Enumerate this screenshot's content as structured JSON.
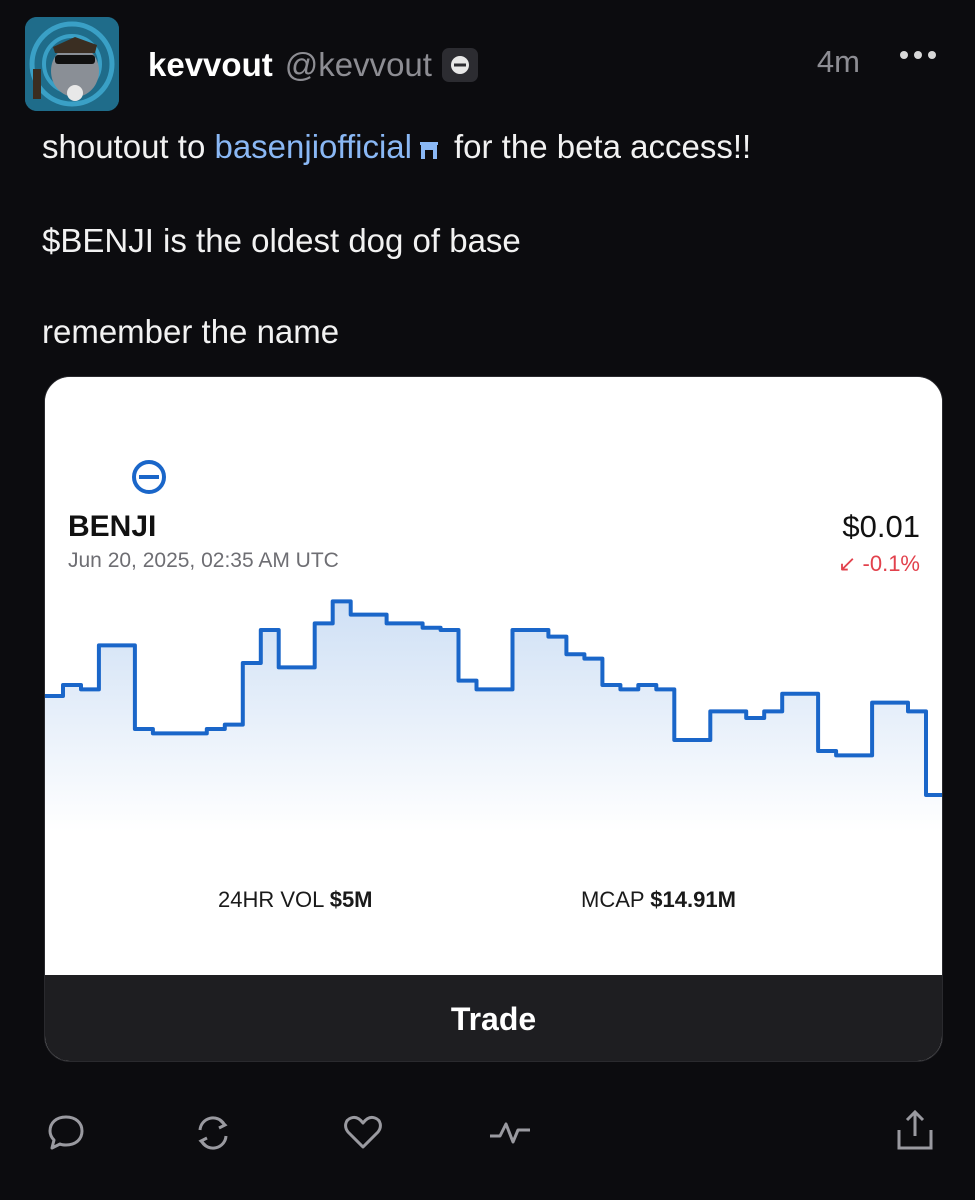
{
  "post": {
    "display_name": "kevvout",
    "handle": "@kevvout",
    "time": "4m",
    "text_line1_before": "shoutout to",
    "mention": "basenjiofficial",
    "text_line1_after": "for the beta access!!",
    "text_line2": "$BENJI is the oldest dog of base",
    "text_line3": "remember the name"
  },
  "card": {
    "token": "BENJI",
    "timestamp": "Jun 20, 2025, 02:35 AM UTC",
    "price": "$0.01",
    "change": "↙ -0.1%",
    "vol_label": "24HR VOL",
    "vol_value": "$5M",
    "mcap_label": "MCAP",
    "mcap_value": "$14.91M",
    "trade_label": "Trade"
  },
  "colors": {
    "accent_blue": "#1a66c9",
    "mention": "#8ab8f5",
    "negative": "#e2414c"
  },
  "icons": [
    "avatar",
    "channel-icon",
    "more-icon",
    "reply-icon",
    "recast-icon",
    "like-icon",
    "activity-icon",
    "share-icon"
  ],
  "chart_data": {
    "type": "line",
    "x": [
      0,
      2,
      4,
      6,
      8,
      10,
      12,
      14,
      16,
      18,
      20,
      22,
      24,
      26,
      28,
      30,
      32,
      34,
      36,
      38,
      40,
      42,
      44,
      46,
      48,
      50,
      52,
      54,
      56,
      58,
      60,
      62,
      64,
      66,
      68,
      70,
      72,
      74,
      76,
      78,
      80,
      82,
      84,
      86,
      88,
      90,
      92,
      94,
      96,
      98,
      100
    ],
    "series": [
      {
        "values": [
          0.55,
          0.6,
          0.58,
          0.78,
          0.78,
          0.4,
          0.38,
          0.38,
          0.38,
          0.4,
          0.42,
          0.7,
          0.85,
          0.68,
          0.68,
          0.88,
          0.98,
          0.92,
          0.92,
          0.88,
          0.88,
          0.86,
          0.85,
          0.62,
          0.58,
          0.58,
          0.85,
          0.85,
          0.82,
          0.74,
          0.72,
          0.6,
          0.58,
          0.6,
          0.58,
          0.35,
          0.35,
          0.48,
          0.48,
          0.45,
          0.48,
          0.56,
          0.56,
          0.3,
          0.28,
          0.28,
          0.52,
          0.52,
          0.48,
          0.1,
          0.06
        ]
      }
    ]
  }
}
